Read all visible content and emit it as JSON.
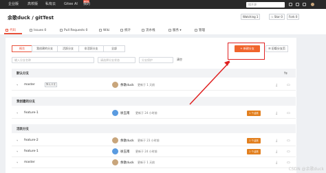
{
  "nav": {
    "items": [
      "企业版",
      "高校版",
      "私有云",
      "Gitee AI",
      "我的"
    ],
    "new_badge": "NEW",
    "search_placeholder": "搜开源"
  },
  "repo": {
    "title": "余歌duck / gitTest",
    "watching_label": "Watching",
    "watching_count": "1",
    "star_label": "Star",
    "star_count": "0",
    "fork_label": "Fork",
    "fork_count": "0"
  },
  "tabs": [
    "代码",
    "Issues",
    "Pull Requests",
    "Wiki",
    "统计",
    "流水线",
    "服务",
    "管理"
  ],
  "tab_counts": {
    "issues": "0",
    "pull_requests": "0"
  },
  "filters": [
    "概览",
    "我创建的分支",
    "活跃分支",
    "非活跃分支",
    "全部"
  ],
  "search": {
    "branch_placeholder": "输入分支名称",
    "select_placeholder": "请选择分支状态",
    "extra_placeholder": "分支保护",
    "clear_label": "清空"
  },
  "buttons": {
    "new_branch": "新建分支",
    "old_branch": "旧版分支页"
  },
  "sections": {
    "default": "默认分支",
    "mine": "我创建的分支",
    "active": "活跃分支"
  },
  "rows": {
    "default": [
      {
        "name": "master",
        "badge": "默认分支",
        "author": "余歌duck",
        "updated": "更新于 1 天前",
        "status": ""
      }
    ],
    "mine": [
      {
        "name": "feature-1",
        "author": "徐玉南",
        "updated": "更新于 24 小时前",
        "status": "1 个活跃"
      }
    ],
    "active": [
      {
        "name": "feature-2",
        "author": "余歌duck",
        "updated": "更新于 23 小时前",
        "status": "1 个活跃"
      },
      {
        "name": "feature-1",
        "author": "徐玉南",
        "updated": "更新于 24 小时前",
        "status": "1 个活跃"
      },
      {
        "name": "master",
        "author": "余歌duck",
        "updated": "更新于 1 天前",
        "status": ""
      }
    ]
  },
  "watermark": "CSDN @余歌duck",
  "colors": {
    "accent": "#f0642c",
    "highlight": "#e02020",
    "nav_bg": "#2a2a2a"
  }
}
